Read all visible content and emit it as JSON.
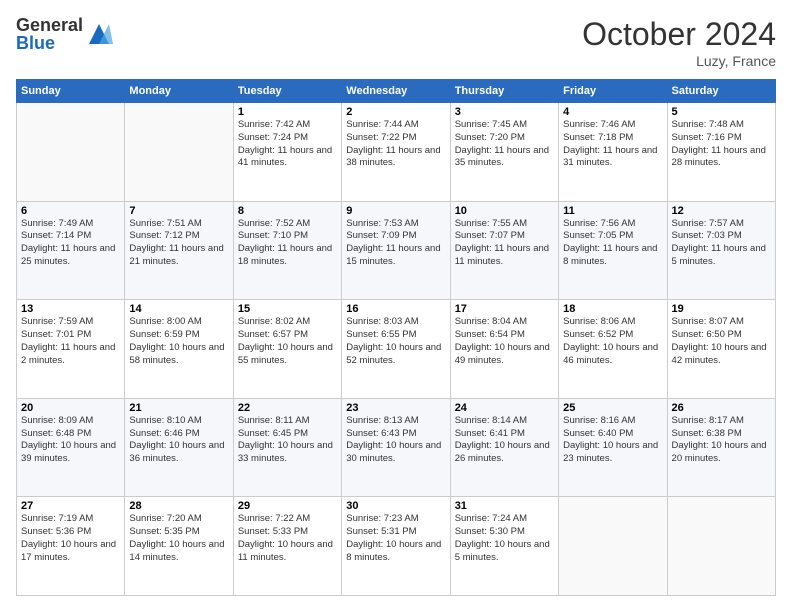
{
  "header": {
    "logo_general": "General",
    "logo_blue": "Blue",
    "month_title": "October 2024",
    "location": "Luzy, France"
  },
  "weekdays": [
    "Sunday",
    "Monday",
    "Tuesday",
    "Wednesday",
    "Thursday",
    "Friday",
    "Saturday"
  ],
  "weeks": [
    [
      {
        "day": "",
        "sunrise": "",
        "sunset": "",
        "daylight": ""
      },
      {
        "day": "",
        "sunrise": "",
        "sunset": "",
        "daylight": ""
      },
      {
        "day": "1",
        "sunrise": "Sunrise: 7:42 AM",
        "sunset": "Sunset: 7:24 PM",
        "daylight": "Daylight: 11 hours and 41 minutes."
      },
      {
        "day": "2",
        "sunrise": "Sunrise: 7:44 AM",
        "sunset": "Sunset: 7:22 PM",
        "daylight": "Daylight: 11 hours and 38 minutes."
      },
      {
        "day": "3",
        "sunrise": "Sunrise: 7:45 AM",
        "sunset": "Sunset: 7:20 PM",
        "daylight": "Daylight: 11 hours and 35 minutes."
      },
      {
        "day": "4",
        "sunrise": "Sunrise: 7:46 AM",
        "sunset": "Sunset: 7:18 PM",
        "daylight": "Daylight: 11 hours and 31 minutes."
      },
      {
        "day": "5",
        "sunrise": "Sunrise: 7:48 AM",
        "sunset": "Sunset: 7:16 PM",
        "daylight": "Daylight: 11 hours and 28 minutes."
      }
    ],
    [
      {
        "day": "6",
        "sunrise": "Sunrise: 7:49 AM",
        "sunset": "Sunset: 7:14 PM",
        "daylight": "Daylight: 11 hours and 25 minutes."
      },
      {
        "day": "7",
        "sunrise": "Sunrise: 7:51 AM",
        "sunset": "Sunset: 7:12 PM",
        "daylight": "Daylight: 11 hours and 21 minutes."
      },
      {
        "day": "8",
        "sunrise": "Sunrise: 7:52 AM",
        "sunset": "Sunset: 7:10 PM",
        "daylight": "Daylight: 11 hours and 18 minutes."
      },
      {
        "day": "9",
        "sunrise": "Sunrise: 7:53 AM",
        "sunset": "Sunset: 7:09 PM",
        "daylight": "Daylight: 11 hours and 15 minutes."
      },
      {
        "day": "10",
        "sunrise": "Sunrise: 7:55 AM",
        "sunset": "Sunset: 7:07 PM",
        "daylight": "Daylight: 11 hours and 11 minutes."
      },
      {
        "day": "11",
        "sunrise": "Sunrise: 7:56 AM",
        "sunset": "Sunset: 7:05 PM",
        "daylight": "Daylight: 11 hours and 8 minutes."
      },
      {
        "day": "12",
        "sunrise": "Sunrise: 7:57 AM",
        "sunset": "Sunset: 7:03 PM",
        "daylight": "Daylight: 11 hours and 5 minutes."
      }
    ],
    [
      {
        "day": "13",
        "sunrise": "Sunrise: 7:59 AM",
        "sunset": "Sunset: 7:01 PM",
        "daylight": "Daylight: 11 hours and 2 minutes."
      },
      {
        "day": "14",
        "sunrise": "Sunrise: 8:00 AM",
        "sunset": "Sunset: 6:59 PM",
        "daylight": "Daylight: 10 hours and 58 minutes."
      },
      {
        "day": "15",
        "sunrise": "Sunrise: 8:02 AM",
        "sunset": "Sunset: 6:57 PM",
        "daylight": "Daylight: 10 hours and 55 minutes."
      },
      {
        "day": "16",
        "sunrise": "Sunrise: 8:03 AM",
        "sunset": "Sunset: 6:55 PM",
        "daylight": "Daylight: 10 hours and 52 minutes."
      },
      {
        "day": "17",
        "sunrise": "Sunrise: 8:04 AM",
        "sunset": "Sunset: 6:54 PM",
        "daylight": "Daylight: 10 hours and 49 minutes."
      },
      {
        "day": "18",
        "sunrise": "Sunrise: 8:06 AM",
        "sunset": "Sunset: 6:52 PM",
        "daylight": "Daylight: 10 hours and 46 minutes."
      },
      {
        "day": "19",
        "sunrise": "Sunrise: 8:07 AM",
        "sunset": "Sunset: 6:50 PM",
        "daylight": "Daylight: 10 hours and 42 minutes."
      }
    ],
    [
      {
        "day": "20",
        "sunrise": "Sunrise: 8:09 AM",
        "sunset": "Sunset: 6:48 PM",
        "daylight": "Daylight: 10 hours and 39 minutes."
      },
      {
        "day": "21",
        "sunrise": "Sunrise: 8:10 AM",
        "sunset": "Sunset: 6:46 PM",
        "daylight": "Daylight: 10 hours and 36 minutes."
      },
      {
        "day": "22",
        "sunrise": "Sunrise: 8:11 AM",
        "sunset": "Sunset: 6:45 PM",
        "daylight": "Daylight: 10 hours and 33 minutes."
      },
      {
        "day": "23",
        "sunrise": "Sunrise: 8:13 AM",
        "sunset": "Sunset: 6:43 PM",
        "daylight": "Daylight: 10 hours and 30 minutes."
      },
      {
        "day": "24",
        "sunrise": "Sunrise: 8:14 AM",
        "sunset": "Sunset: 6:41 PM",
        "daylight": "Daylight: 10 hours and 26 minutes."
      },
      {
        "day": "25",
        "sunrise": "Sunrise: 8:16 AM",
        "sunset": "Sunset: 6:40 PM",
        "daylight": "Daylight: 10 hours and 23 minutes."
      },
      {
        "day": "26",
        "sunrise": "Sunrise: 8:17 AM",
        "sunset": "Sunset: 6:38 PM",
        "daylight": "Daylight: 10 hours and 20 minutes."
      }
    ],
    [
      {
        "day": "27",
        "sunrise": "Sunrise: 7:19 AM",
        "sunset": "Sunset: 5:36 PM",
        "daylight": "Daylight: 10 hours and 17 minutes."
      },
      {
        "day": "28",
        "sunrise": "Sunrise: 7:20 AM",
        "sunset": "Sunset: 5:35 PM",
        "daylight": "Daylight: 10 hours and 14 minutes."
      },
      {
        "day": "29",
        "sunrise": "Sunrise: 7:22 AM",
        "sunset": "Sunset: 5:33 PM",
        "daylight": "Daylight: 10 hours and 11 minutes."
      },
      {
        "day": "30",
        "sunrise": "Sunrise: 7:23 AM",
        "sunset": "Sunset: 5:31 PM",
        "daylight": "Daylight: 10 hours and 8 minutes."
      },
      {
        "day": "31",
        "sunrise": "Sunrise: 7:24 AM",
        "sunset": "Sunset: 5:30 PM",
        "daylight": "Daylight: 10 hours and 5 minutes."
      },
      {
        "day": "",
        "sunrise": "",
        "sunset": "",
        "daylight": ""
      },
      {
        "day": "",
        "sunrise": "",
        "sunset": "",
        "daylight": ""
      }
    ]
  ]
}
